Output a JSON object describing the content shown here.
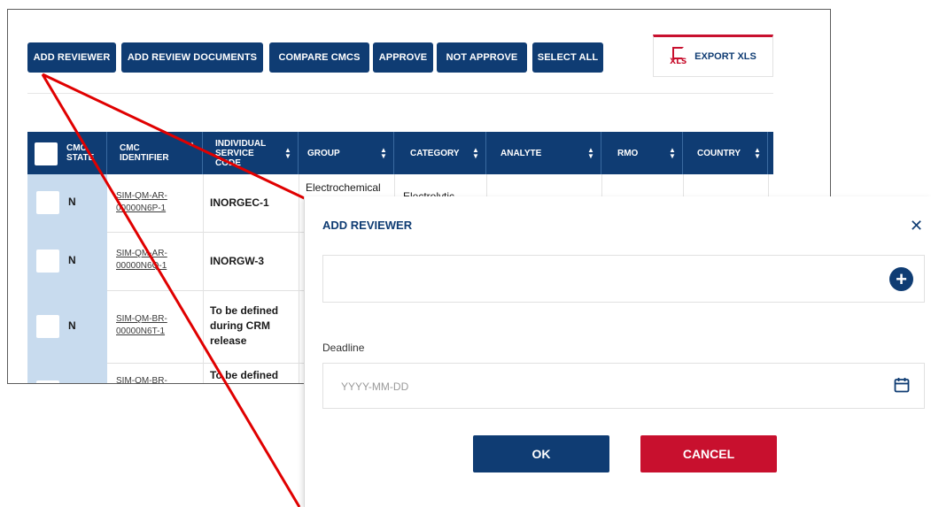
{
  "toolbar": {
    "buttons": [
      {
        "label": "ADD REVIEWER"
      },
      {
        "label": "ADD REVIEW DOCUMENTS"
      },
      {
        "label": "COMPARE CMCS"
      },
      {
        "label": "APPROVE"
      },
      {
        "label": "NOT APPROVE"
      },
      {
        "label": "SELECT ALL"
      }
    ],
    "export_label": "EXPORT XLS",
    "export_icon": "xls-file-icon",
    "export_icon_text": "XLS"
  },
  "table": {
    "headers": [
      {
        "label": "CMC\nSTATE"
      },
      {
        "label": "CMC\nIDENTIFIER"
      },
      {
        "label": "INDIVIDUAL\nSERVICE\nCODE"
      },
      {
        "label": "GROUP"
      },
      {
        "label": "CATEGORY"
      },
      {
        "label": "ANALYTE"
      },
      {
        "label": "RMO"
      },
      {
        "label": "COUNTRY"
      }
    ],
    "rows": [
      {
        "state": "N",
        "identifier": "SIM-QM-AR-00000N6P-1",
        "code": "INORGEC-1",
        "group": "Electrochemical",
        "category": "Electrolytic"
      },
      {
        "state": "N",
        "identifier": "SIM-QM-AR-00000N6Q-1",
        "code": "INORGW-3",
        "group": "",
        "category": ""
      },
      {
        "state": "N",
        "identifier": "SIM-QM-BR-00000N6T-1",
        "code": "To be defined during CRM release",
        "group": "",
        "category": ""
      },
      {
        "state": "",
        "identifier": "SIM-QM-BR-",
        "code": "To be defined",
        "group": "",
        "category": ""
      }
    ]
  },
  "modal": {
    "title": "ADD REVIEWER",
    "close_icon": "close-icon",
    "reviewer_value": "",
    "add_icon": "plus-circle-icon",
    "deadline_label": "Deadline",
    "deadline_placeholder": "YYYY-MM-DD",
    "calendar_icon": "calendar-icon",
    "ok_label": "OK",
    "cancel_label": "CANCEL"
  },
  "colors": {
    "primary": "#0f3c73",
    "danger": "#c8102e",
    "state_column": "#c8dbee",
    "annotation": "#e00000"
  }
}
